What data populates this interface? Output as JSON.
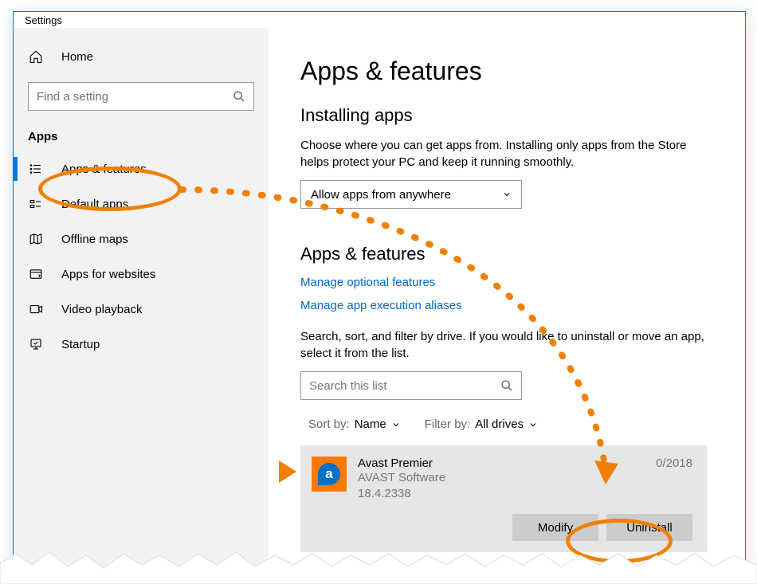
{
  "window": {
    "title": "Settings"
  },
  "sidebar": {
    "home_label": "Home",
    "search_placeholder": "Find a setting",
    "section_title": "Apps",
    "items": [
      {
        "label": "Apps & features"
      },
      {
        "label": "Default apps"
      },
      {
        "label": "Offline maps"
      },
      {
        "label": "Apps for websites"
      },
      {
        "label": "Video playback"
      },
      {
        "label": "Startup"
      }
    ]
  },
  "main": {
    "page_title": "Apps & features",
    "installing": {
      "heading": "Installing apps",
      "description": "Choose where you can get apps from. Installing only apps from the Store helps protect your PC and keep it running smoothly.",
      "dropdown_value": "Allow apps from anywhere"
    },
    "apps_features": {
      "heading": "Apps & features",
      "link_optional": "Manage optional features",
      "link_aliases": "Manage app execution aliases",
      "filter_text": "Search, sort, and filter by drive. If you would like to uninstall or move an app, select it from the list.",
      "search_placeholder": "Search this list",
      "sort_label": "Sort by:",
      "sort_value": "Name",
      "filter_label": "Filter by:",
      "filter_value": "All drives"
    },
    "app": {
      "name": "Avast Premier",
      "vendor": "AVAST Software",
      "version": "18.4.2338",
      "date_visible": "0/2018",
      "modify_label": "Modify",
      "uninstall_label": "Uninstall"
    }
  },
  "colors": {
    "accent": "#0078d7",
    "annotation": "#f08000",
    "link": "#0066cc"
  }
}
